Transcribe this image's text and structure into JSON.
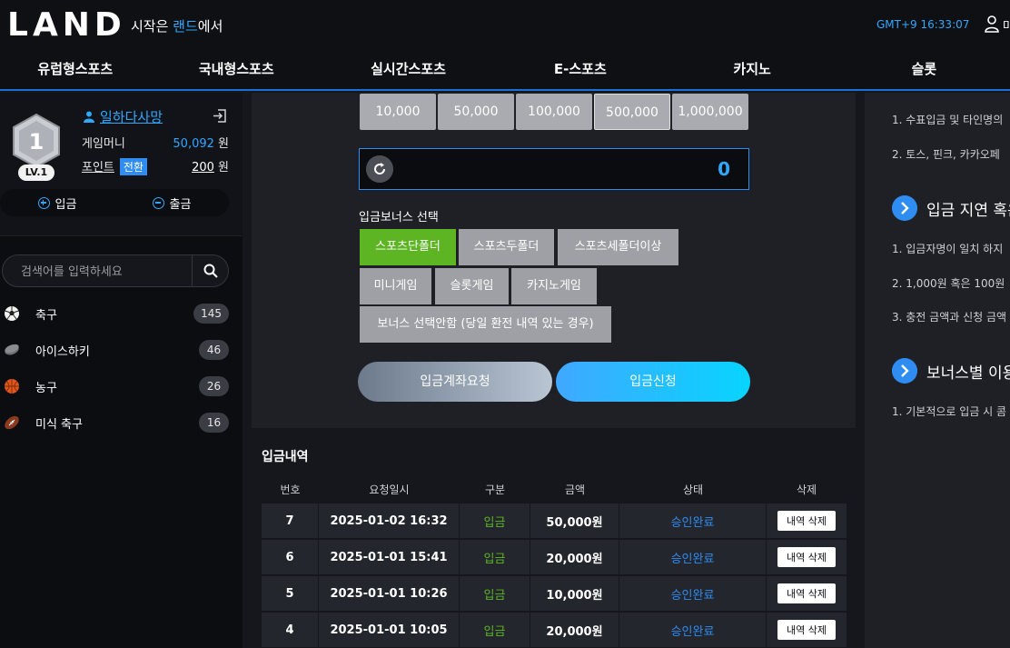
{
  "header": {
    "logo": "LAND",
    "tagline_pre": "시작은 ",
    "tagline_hl": "랜드",
    "tagline_post": "에서",
    "clock": "GMT+9 16:33:07",
    "user_extra": "마"
  },
  "nav": [
    "유럽형스포츠",
    "국내형스포츠",
    "실시간스포츠",
    "E-스포츠",
    "카지노",
    "슬롯"
  ],
  "profile": {
    "level_number": "1",
    "level": "LV.1",
    "username": "일하다사망",
    "money_label": "게임머니",
    "money_value": "50,092",
    "money_unit": " 원",
    "point_label": "포인트",
    "switch_label": "전환",
    "point_value": "200",
    "point_unit": " 원",
    "deposit_label": "입금",
    "withdraw_label": "출금"
  },
  "search": {
    "placeholder": "검색어를 입력하세요"
  },
  "sports": [
    {
      "name": "축구",
      "count": "145"
    },
    {
      "name": "아이스하키",
      "count": "46"
    },
    {
      "name": "농구",
      "count": "26"
    },
    {
      "name": "미식 축구",
      "count": "16"
    }
  ],
  "amounts": [
    "10,000",
    "50,000",
    "100,000",
    "500,000",
    "1,000,000"
  ],
  "amount_value": "0",
  "bonus": {
    "label": "입금보너스 선택",
    "options": [
      "스포츠단폴더",
      "스포츠두폴더",
      "스포츠세폴더이상",
      "미니게임",
      "슬롯게임",
      "카지노게임",
      "보너스 선택안함 (당일 환전 내역 있는 경우)"
    ]
  },
  "buttons": {
    "request": "입금계좌요청",
    "apply": "입금신청"
  },
  "history": {
    "title": "입금내역",
    "columns": [
      "번호",
      "요청일시",
      "구분",
      "금액",
      "상태",
      "삭제"
    ],
    "rows": [
      {
        "no": "7",
        "date": "2025-01-02 16:32",
        "kind": "입금",
        "amount": "50,000원",
        "status": "승인완료",
        "action": "내역 삭제"
      },
      {
        "no": "6",
        "date": "2025-01-01 15:41",
        "kind": "입금",
        "amount": "20,000원",
        "status": "승인완료",
        "action": "내역 삭제"
      },
      {
        "no": "5",
        "date": "2025-01-01 10:26",
        "kind": "입금",
        "amount": "10,000원",
        "status": "승인완료",
        "action": "내역 삭제"
      },
      {
        "no": "4",
        "date": "2025-01-01 10:05",
        "kind": "입금",
        "amount": "20,000원",
        "status": "승인완료",
        "action": "내역 삭제"
      }
    ]
  },
  "notice": {
    "l1": "1. 수표입금 및 타인명의",
    "l2": "2. 토스, 핀크, 카카오페",
    "h1": "입금 지연 혹은",
    "l3": "1. 입금자명이 일치 하지",
    "l4": "2. 1,000원 혹은 100원",
    "l5": "3. 충전 금액과 신청 금액",
    "h2": "보너스별 이용",
    "l6": "1. 기본적으로 입금 시 콤"
  }
}
